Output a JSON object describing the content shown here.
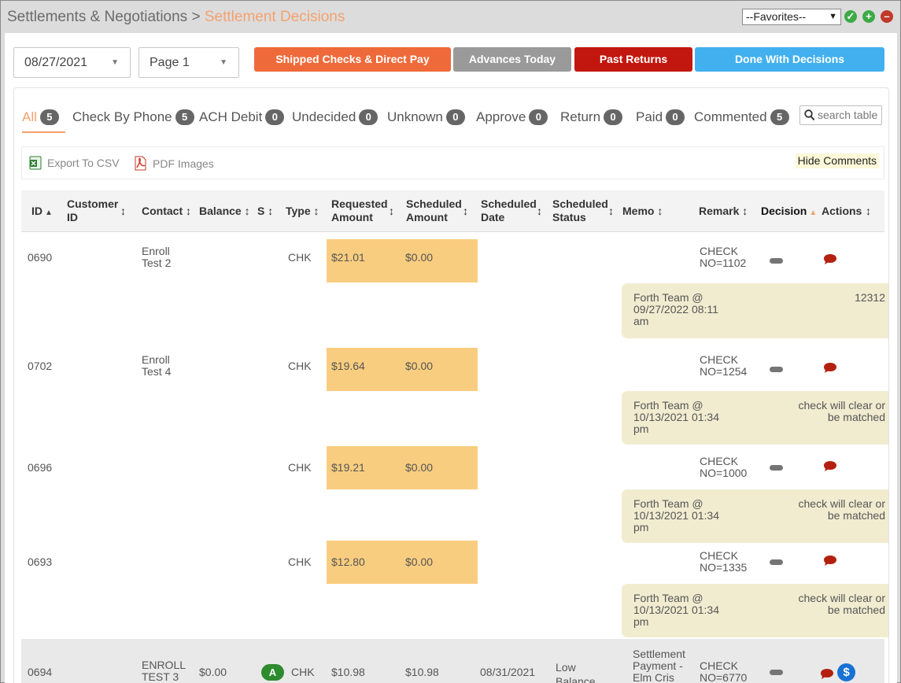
{
  "header": {
    "breadcrumb_parent": "Settlements & Negotiations",
    "breadcrumb_sep": ">",
    "breadcrumb_current": "Settlement Decisions",
    "favorites_value": "--Favorites--",
    "colors": {
      "accent": "#f4a26e",
      "green": "#2ea043",
      "red": "#c0392b"
    }
  },
  "filters": {
    "date": "08/27/2021",
    "page": "Page 1"
  },
  "buttons": {
    "shipped": "Shipped Checks & Direct Pay",
    "advances": "Advances Today",
    "past_returns": "Past Returns",
    "done": "Done With Decisions",
    "colors": {
      "shipped": "#ef6a3a",
      "advances": "#9a9a9a",
      "past_returns": "#c2170f",
      "done": "#42b0ef"
    }
  },
  "tabs": [
    {
      "label": "All",
      "count": "5"
    },
    {
      "label": "Check By Phone",
      "count": "5"
    },
    {
      "label": "ACH Debit",
      "count": "0"
    },
    {
      "label": "Undecided",
      "count": "0"
    },
    {
      "label": "Unknown",
      "count": "0"
    },
    {
      "label": "Approve",
      "count": "0"
    },
    {
      "label": "Return",
      "count": "0"
    },
    {
      "label": "Paid",
      "count": "0"
    },
    {
      "label": "Commented",
      "count": "5"
    }
  ],
  "search": {
    "placeholder": "search table"
  },
  "toolbar": {
    "export_csv": "Export To CSV",
    "pdf_images": "PDF Images",
    "hide_comments": "Hide Comments"
  },
  "table": {
    "headers": {
      "id": "ID",
      "customer_id_1": "Customer",
      "customer_id_2": "ID",
      "contact": "Contact",
      "balance": "Balance",
      "s": "S",
      "type": "Type",
      "requested_1": "Requested",
      "requested_2": "Amount",
      "scheduled_amount_1": "Scheduled",
      "scheduled_amount_2": "Amount",
      "scheduled_date_1": "Scheduled",
      "scheduled_date_2": "Date",
      "scheduled_status_1": "Scheduled",
      "scheduled_status_2": "Status",
      "memo": "Memo",
      "remark": "Remark",
      "decision": "Decision",
      "actions": "Actions"
    },
    "rows": [
      {
        "id": "0690",
        "contact_1": "Enroll",
        "contact_2": "Test 2",
        "type": "CHK",
        "requested": "$21.01",
        "scheduled": "$0.00",
        "remark_1": "CHECK",
        "remark_2": "NO=1102",
        "comment_who_1": "Forth Team @",
        "comment_who_2": "09/27/2022 08:11",
        "comment_who_3": "am",
        "comment_text_1": "12312",
        "comment_text_2": ""
      },
      {
        "id": "0702",
        "contact_1": "Enroll",
        "contact_2": "Test 4",
        "type": "CHK",
        "requested": "$19.64",
        "scheduled": "$0.00",
        "remark_1": "CHECK",
        "remark_2": "NO=1254",
        "comment_who_1": "Forth Team @",
        "comment_who_2": "10/13/2021 01:34",
        "comment_who_3": "pm",
        "comment_text_1": "check will clear or",
        "comment_text_2": "be matched"
      },
      {
        "id": "0696",
        "contact_1": "",
        "contact_2": "",
        "type": "CHK",
        "requested": "$19.21",
        "scheduled": "$0.00",
        "remark_1": "CHECK",
        "remark_2": "NO=1000",
        "comment_who_1": "Forth Team @",
        "comment_who_2": "10/13/2021 01:34",
        "comment_who_3": "pm",
        "comment_text_1": "check will clear or",
        "comment_text_2": "be matched"
      },
      {
        "id": "0693",
        "contact_1": "",
        "contact_2": "",
        "type": "CHK",
        "requested": "$12.80",
        "scheduled": "$0.00",
        "remark_1": "CHECK",
        "remark_2": "NO=1335",
        "comment_who_1": "Forth Team @",
        "comment_who_2": "10/13/2021 01:34",
        "comment_who_3": "pm",
        "comment_text_1": "check will clear or",
        "comment_text_2": "be matched"
      },
      {
        "id": "0694",
        "contact_1": "ENROLL",
        "contact_2": "TEST 3",
        "balance": "$0.00",
        "s_badge": "A",
        "type": "CHK",
        "requested": "$10.98",
        "scheduled": "$10.98",
        "scheduled_date": "08/31/2021",
        "status_1": "Low",
        "status_2": "Balance",
        "memo_1": "Settlement",
        "memo_2": "Payment -",
        "memo_3": "Elm Cris",
        "remark_1": "CHECK",
        "remark_2": "NO=6770",
        "action_dollar": "$"
      }
    ]
  }
}
